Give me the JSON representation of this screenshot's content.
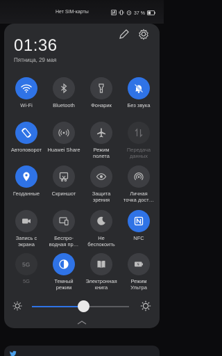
{
  "status": {
    "carrier": "Нет SIM-карты",
    "battery": "37 %"
  },
  "header": {
    "time": "01:36",
    "date": "Пятница, 29 мая"
  },
  "tiles": [
    {
      "label": "Wi-Fi",
      "icon": "wifi-icon",
      "state": "on"
    },
    {
      "label": "Bluetooth",
      "icon": "bluetooth-icon",
      "state": "off"
    },
    {
      "label": "Фонарик",
      "icon": "flashlight-icon",
      "state": "off"
    },
    {
      "label": "Без звука",
      "icon": "bell-off-icon",
      "state": "on"
    },
    {
      "label": "Автоповорот",
      "icon": "auto-rotate-icon",
      "state": "on"
    },
    {
      "label": "Huawei Share",
      "icon": "huawei-share-icon",
      "state": "off"
    },
    {
      "label": "Режим\nполета",
      "icon": "airplane-icon",
      "state": "off"
    },
    {
      "label": "Передача\nданных",
      "icon": "mobile-data-icon",
      "state": "disabled"
    },
    {
      "label": "Геоданные",
      "icon": "location-icon",
      "state": "on"
    },
    {
      "label": "Скриншот",
      "icon": "screenshot-icon",
      "state": "off"
    },
    {
      "label": "Защита\nзрения",
      "icon": "eye-icon",
      "state": "off"
    },
    {
      "label": "Личная\nточка дост…",
      "icon": "hotspot-icon",
      "state": "off"
    },
    {
      "label": "Запись с\nэкрана",
      "icon": "screen-record-icon",
      "state": "off"
    },
    {
      "label": "Беспро-\nводная пр…",
      "icon": "wireless-projection-icon",
      "state": "off"
    },
    {
      "label": "Не\nбеспокоить",
      "icon": "moon-icon",
      "state": "off"
    },
    {
      "label": "NFC",
      "icon": "nfc-icon",
      "state": "on"
    },
    {
      "label": "5G",
      "icon": "5g-icon",
      "state": "disabled"
    },
    {
      "label": "Темный\nрежим",
      "icon": "dark-mode-icon",
      "state": "on"
    },
    {
      "label": "Электронная\nкнига",
      "icon": "ebook-icon",
      "state": "off"
    },
    {
      "label": "Режим\nУльтра",
      "icon": "battery-ultra-icon",
      "state": "off"
    }
  ],
  "brightness": {
    "level": 0.53
  },
  "colors": {
    "accent": "#2f73e6",
    "panel": "#2a2b2e",
    "tile_off": "#3d3e42"
  }
}
